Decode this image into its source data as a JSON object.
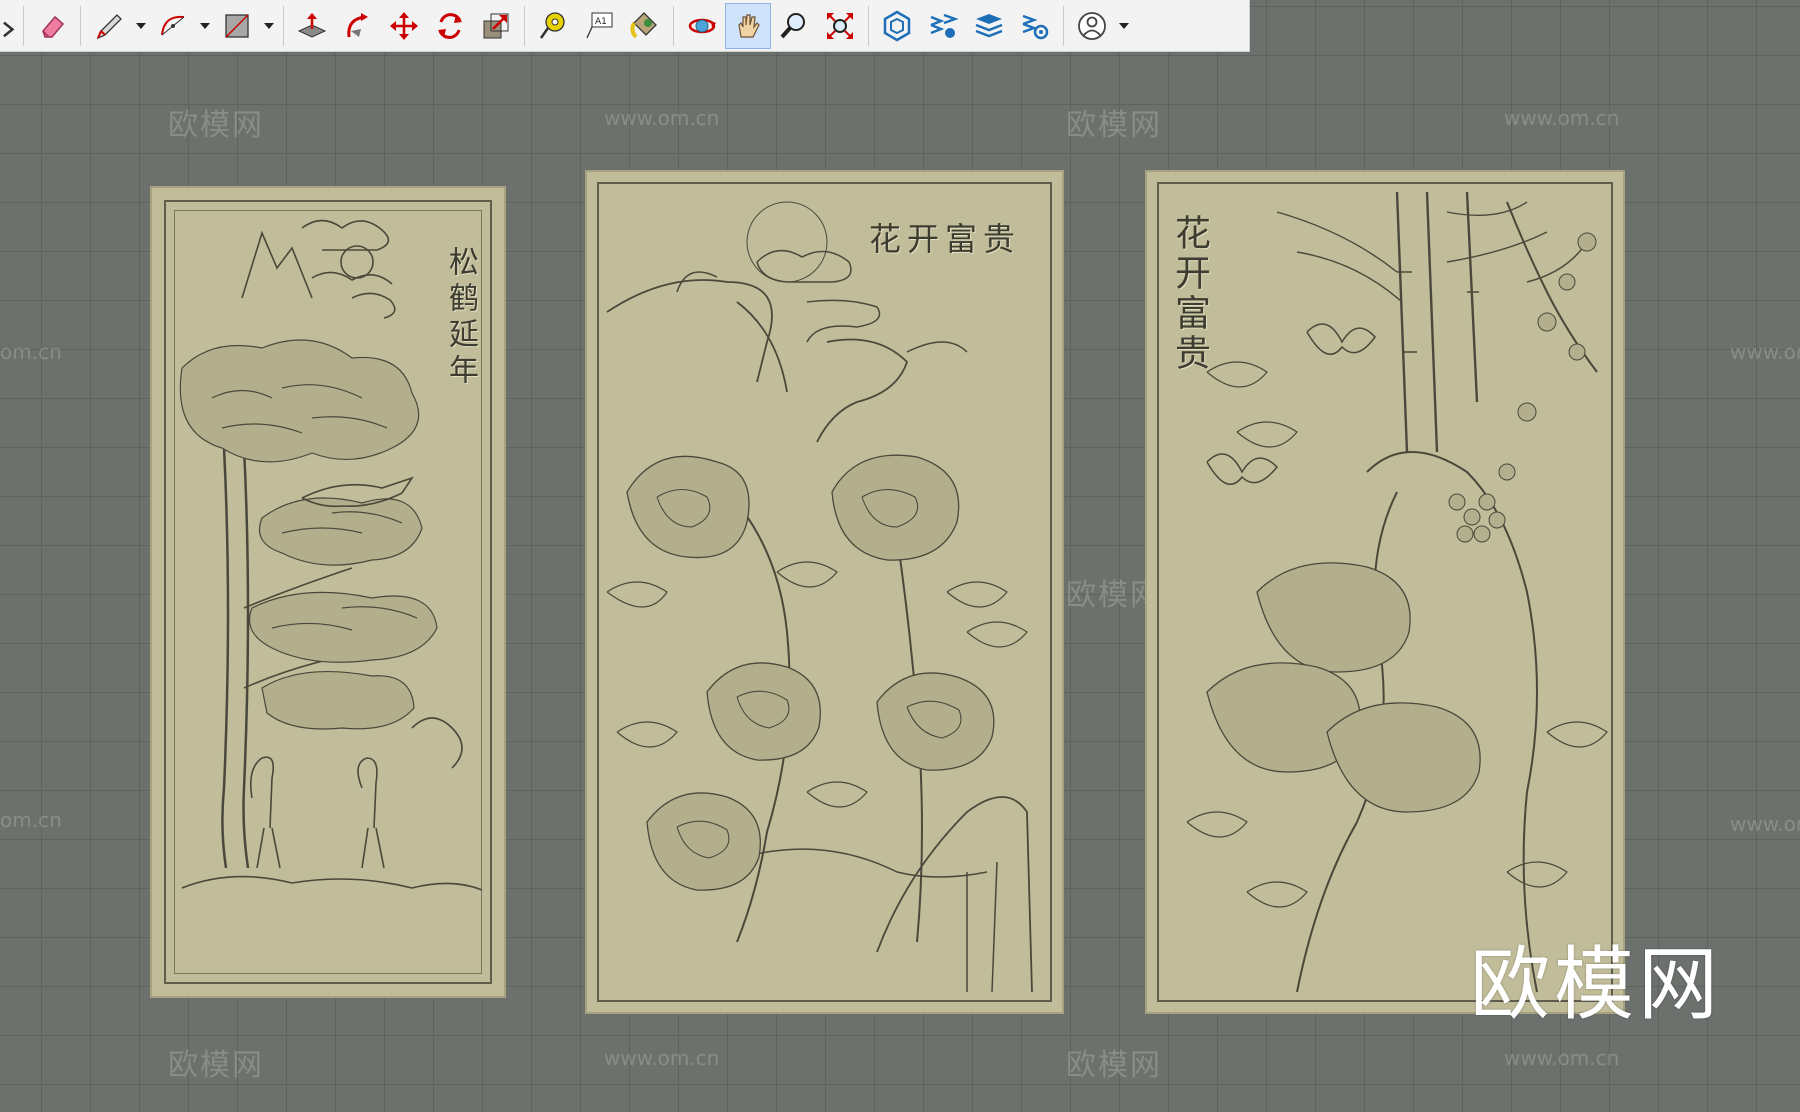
{
  "toolbar": {
    "tools": [
      {
        "name": "eraser-icon"
      },
      {
        "name": "pencil-icon"
      },
      {
        "name": "arc-icon"
      },
      {
        "name": "rectangle-icon"
      },
      {
        "name": "push-pull-icon"
      },
      {
        "name": "follow-me-icon"
      },
      {
        "name": "move-icon"
      },
      {
        "name": "rotate-icon"
      },
      {
        "name": "scale-icon"
      },
      {
        "name": "tape-measure-icon"
      },
      {
        "name": "text-icon"
      },
      {
        "name": "paint-bucket-icon"
      },
      {
        "name": "orbit-icon"
      },
      {
        "name": "pan-icon"
      },
      {
        "name": "zoom-icon"
      },
      {
        "name": "zoom-extents-icon"
      },
      {
        "name": "warehouse-icon"
      },
      {
        "name": "extension-warehouse-icon"
      },
      {
        "name": "layers-icon"
      },
      {
        "name": "extension-manager-icon"
      },
      {
        "name": "account-icon"
      }
    ],
    "active_tool": "pan-icon",
    "text_tool_label": "A1"
  },
  "watermarks": {
    "brand": "欧模网",
    "url": "www.om.cn",
    "url_partial": "om.cn",
    "big": "欧模网"
  },
  "panels": {
    "left": {
      "inscription": "松鹤延年"
    },
    "middle": {
      "inscription": "花开富贵"
    },
    "right": {
      "inscription": "花开富贵"
    }
  },
  "colors": {
    "background": "#6d716d",
    "grid": "#5f635f",
    "panel": "#c1bd9a",
    "engraving": "#4a483a"
  }
}
